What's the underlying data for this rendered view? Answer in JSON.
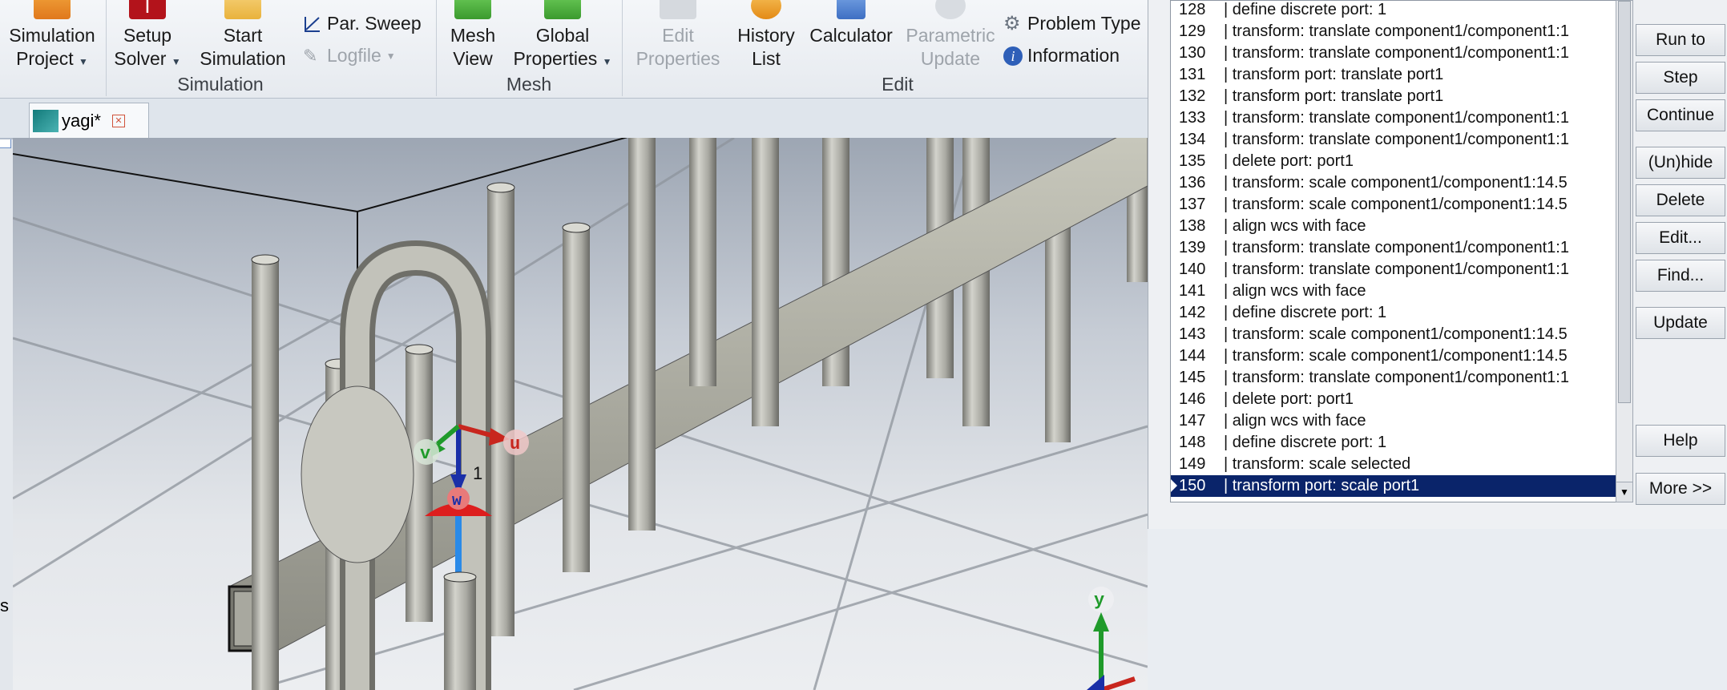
{
  "ribbon": {
    "simulation_project": "Simulation\nProject",
    "simulation_project_l1": "Simulation",
    "simulation_project_l2": "Project",
    "setup_solver_l1": "Setup",
    "setup_solver_l2": "Solver",
    "start_simulation_l1": "Start",
    "start_simulation_l2": "Simulation",
    "par_sweep": "Par. Sweep",
    "logfile": "Logfile",
    "group_simulation": "Simulation",
    "mesh_view_l1": "Mesh",
    "mesh_view_l2": "View",
    "global_properties_l1": "Global",
    "global_properties_l2": "Properties",
    "group_mesh": "Mesh",
    "edit_properties_l1": "Edit",
    "edit_properties_l2": "Properties",
    "history_list_l1": "History",
    "history_list_l2": "List",
    "calculator": "Calculator",
    "parametric_update_l1": "Parametric",
    "parametric_update_l2": "Update",
    "problem_type": "Problem Type",
    "information": "Information",
    "group_edit": "Edit"
  },
  "tabs": {
    "active_tab": "yagi*"
  },
  "viewport": {
    "axis_u": "u",
    "axis_v": "v",
    "axis_w": "w",
    "port_label": "1",
    "corner_axis_y": "y"
  },
  "history": {
    "rows": [
      {
        "num": "128",
        "text": "| define discrete port: 1"
      },
      {
        "num": "129",
        "text": "| transform: translate component1/component1:1"
      },
      {
        "num": "130",
        "text": "| transform: translate component1/component1:1"
      },
      {
        "num": "131",
        "text": "| transform port: translate port1"
      },
      {
        "num": "132",
        "text": "| transform port: translate port1"
      },
      {
        "num": "133",
        "text": "| transform: translate component1/component1:1"
      },
      {
        "num": "134",
        "text": "| transform: translate component1/component1:1"
      },
      {
        "num": "135",
        "text": "| delete port: port1"
      },
      {
        "num": "136",
        "text": "| transform: scale component1/component1:14.5"
      },
      {
        "num": "137",
        "text": "| transform: scale component1/component1:14.5"
      },
      {
        "num": "138",
        "text": "| align wcs with face"
      },
      {
        "num": "139",
        "text": "| transform: translate component1/component1:1"
      },
      {
        "num": "140",
        "text": "| transform: translate component1/component1:1"
      },
      {
        "num": "141",
        "text": "| align wcs with face"
      },
      {
        "num": "142",
        "text": "| define discrete port: 1"
      },
      {
        "num": "143",
        "text": "| transform: scale component1/component1:14.5"
      },
      {
        "num": "144",
        "text": "| transform: scale component1/component1:14.5"
      },
      {
        "num": "145",
        "text": "| transform: translate component1/component1:1"
      },
      {
        "num": "146",
        "text": "| delete port: port1"
      },
      {
        "num": "147",
        "text": "| align wcs with face"
      },
      {
        "num": "148",
        "text": "| define discrete port: 1"
      },
      {
        "num": "149",
        "text": "| transform: scale selected"
      },
      {
        "num": "150",
        "text": "| transform port: scale port1"
      }
    ],
    "buttons": {
      "run_to": "Run to",
      "step": "Step",
      "continue": "Continue",
      "unhide": "(Un)hide",
      "delete": "Delete",
      "edit": "Edit...",
      "find": "Find...",
      "update": "Update",
      "help": "Help",
      "more": "More >>"
    }
  },
  "left_edge_char": "s"
}
